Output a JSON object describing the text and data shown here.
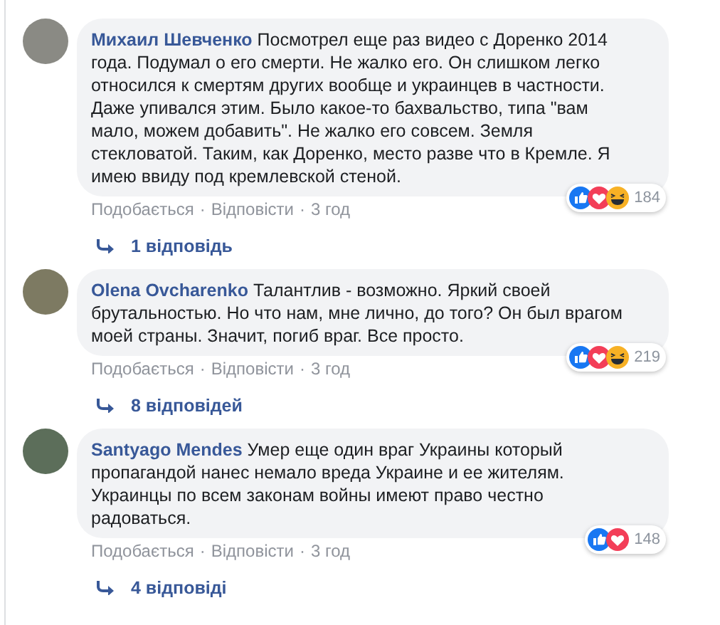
{
  "comments": [
    {
      "author": "Михаил Шевченко",
      "text": "Посмотрел еще раз видео с Доренко 2014 года. Подумал о его смерти. Не жалко его. Он слишком легко относился к смертям других вообще и украинцев в частности. Даже упивался этим. Было какое-то бахвальство, типа \"вам мало, можем добавить\". Не жалко его совсем. Земля стекловатой. Таким, как Доренко, место разве что в Кремле. Я имею ввиду под кремлевской стеной.",
      "reactions": [
        {
          "kind": "like"
        },
        {
          "kind": "love"
        },
        {
          "kind": "haha"
        }
      ],
      "reaction_count": "184",
      "actions": [
        {
          "kind": "item",
          "text": "Подобається"
        },
        {
          "kind": "separator",
          "text": "·"
        },
        {
          "kind": "item",
          "text": "Відповісти"
        },
        {
          "kind": "separator",
          "text": "·"
        },
        {
          "kind": "item",
          "text": "3 год"
        }
      ],
      "replies": "1 відповідь"
    },
    {
      "author": "Olena Ovcharenko",
      "text": "Талантлив - возможно. Яркий своей брутальностью. Но что нам, мне лично, до того? Он был врагом моей страны. Значит, погиб враг. Все просто.",
      "reactions": [
        {
          "kind": "like"
        },
        {
          "kind": "love"
        },
        {
          "kind": "haha"
        }
      ],
      "reaction_count": "219",
      "actions": [
        {
          "kind": "item",
          "text": "Подобається"
        },
        {
          "kind": "separator",
          "text": "·"
        },
        {
          "kind": "item",
          "text": "Відповісти"
        },
        {
          "kind": "separator",
          "text": "·"
        },
        {
          "kind": "item",
          "text": "3 год"
        }
      ],
      "replies": "8 відповідей"
    },
    {
      "author": "Santyago Mendes",
      "text": "Умер еще один враг Украины который пропагандой нанес немало вреда Украине и ее жителям. Украинцы по всем законам войны имеют право честно радоваться.",
      "reactions": [
        {
          "kind": "like"
        },
        {
          "kind": "love"
        }
      ],
      "reaction_count": "148",
      "actions": [
        {
          "kind": "item",
          "text": "Подобається"
        },
        {
          "kind": "separator",
          "text": "·"
        },
        {
          "kind": "item",
          "text": "Відповісти"
        },
        {
          "kind": "separator",
          "text": "·"
        },
        {
          "kind": "item",
          "text": "3 год"
        }
      ],
      "replies": "4 відповіді"
    }
  ]
}
